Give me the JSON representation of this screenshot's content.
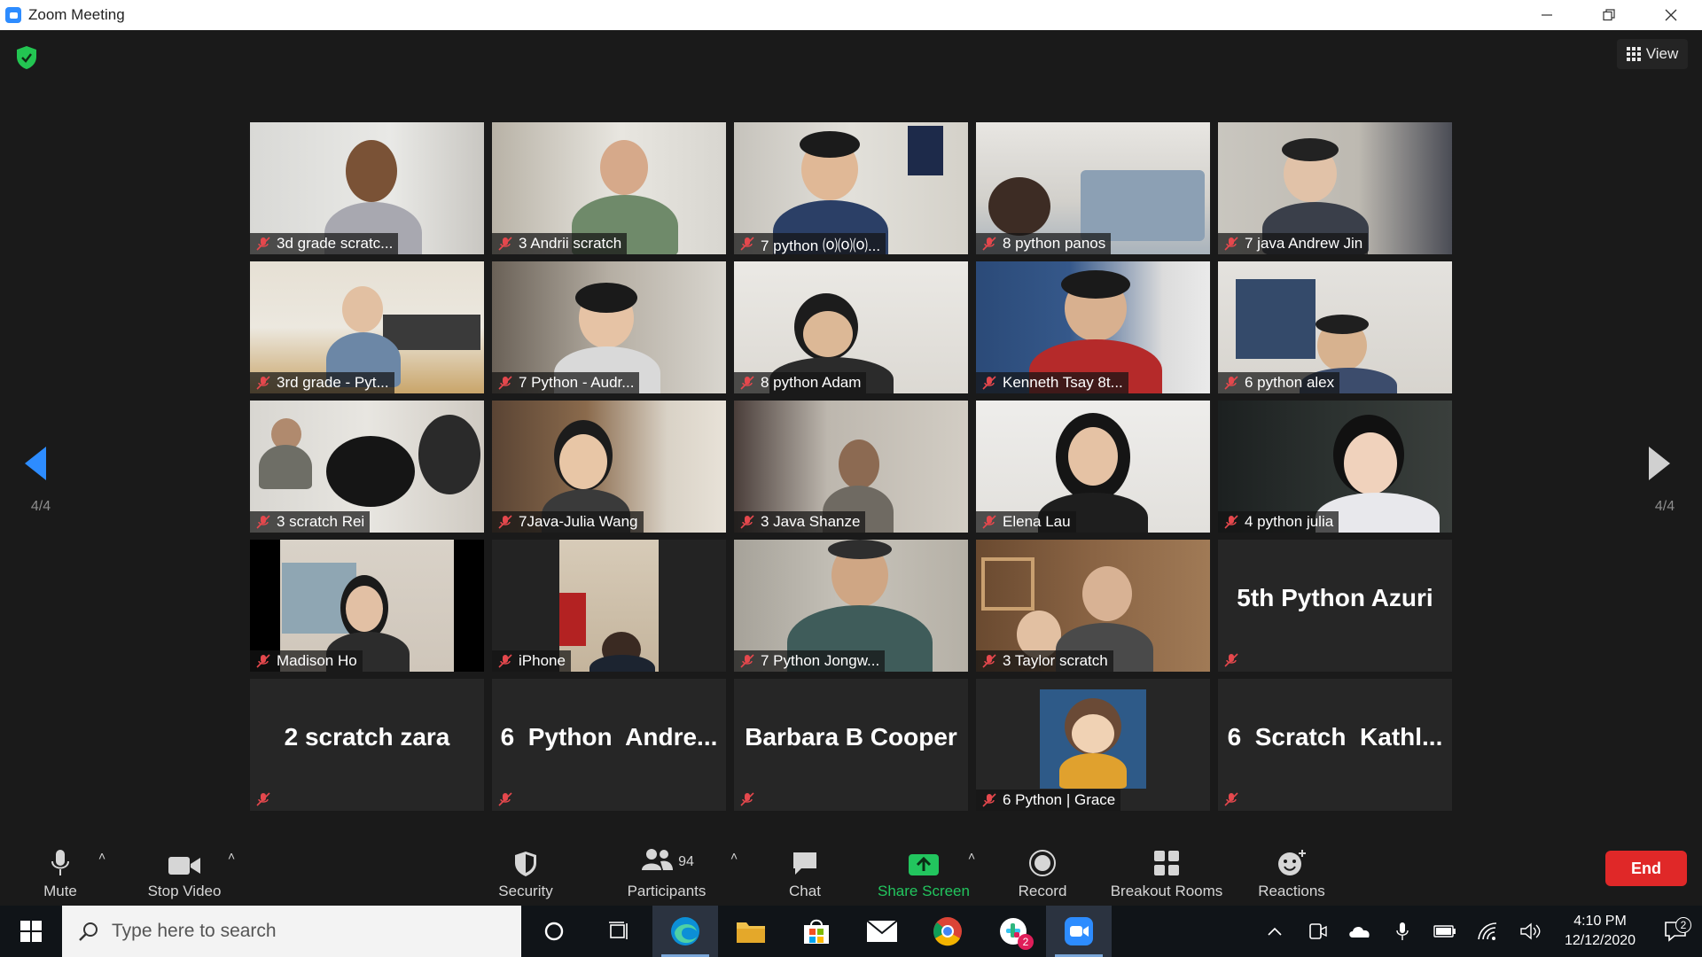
{
  "window": {
    "title": "Zoom Meeting"
  },
  "header": {
    "view_label": "View"
  },
  "pagination": {
    "left": "4/4",
    "right": "4/4"
  },
  "participants": [
    {
      "name": "3d grade scratc...",
      "video": true
    },
    {
      "name": "3 Andrii scratch",
      "video": true
    },
    {
      "name": "7 python ⒪⒪⒪...",
      "video": true
    },
    {
      "name": "8 python panos",
      "video": true
    },
    {
      "name": "7 java Andrew Jin",
      "video": true
    },
    {
      "name": "3rd grade - Pyt...",
      "video": true
    },
    {
      "name": "7 Python - Audr...",
      "video": true
    },
    {
      "name": "8 python Adam",
      "video": true
    },
    {
      "name": "Kenneth Tsay 8t...",
      "video": true
    },
    {
      "name": "6 python alex",
      "video": true
    },
    {
      "name": "3 scratch Rei",
      "video": true
    },
    {
      "name": "7Java-Julia Wang",
      "video": true
    },
    {
      "name": "3 Java Shanze",
      "video": true
    },
    {
      "name": "Elena Lau",
      "video": true
    },
    {
      "name": "4 python julia",
      "video": true
    },
    {
      "name": "Madison Ho",
      "video": true
    },
    {
      "name": "iPhone",
      "video": true
    },
    {
      "name": "7 Python Jongw...",
      "video": true
    },
    {
      "name": "3 Taylor scratch",
      "video": true
    },
    {
      "name": "5th Python Azuri",
      "video": false
    },
    {
      "name": "2 scratch zara",
      "video": false
    },
    {
      "name": "6  Python  Andre...",
      "video": false
    },
    {
      "name": "Barbara B Cooper",
      "video": false
    },
    {
      "name": "6 Python | Grace",
      "video": true
    },
    {
      "name": "6  Scratch  Kathl...",
      "video": false
    }
  ],
  "toolbar": {
    "mute": "Mute",
    "stop_video": "Stop Video",
    "security": "Security",
    "participants": "Participants",
    "participants_count": "94",
    "chat": "Chat",
    "share_screen": "Share Screen",
    "record": "Record",
    "breakout_rooms": "Breakout Rooms",
    "reactions": "Reactions",
    "end": "End"
  },
  "taskbar": {
    "search_placeholder": "Type here to search",
    "time": "4:10 PM",
    "date": "12/12/2020",
    "notification_count": "2",
    "slack_badge": "2"
  },
  "colors": {
    "accent_blue": "#2d8cff",
    "share_green": "#22c55e",
    "end_red": "#e02828",
    "mute_red": "#e5484d"
  }
}
